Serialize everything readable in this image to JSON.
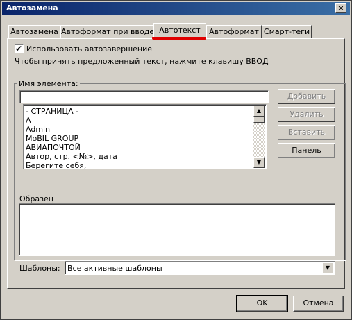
{
  "window": {
    "title": "Автозамена",
    "close_glyph": "×"
  },
  "tabs": [
    {
      "label": "Автозамена"
    },
    {
      "label": "Автоформат при вводе"
    },
    {
      "label": "Автотекст"
    },
    {
      "label": "Автоформат"
    },
    {
      "label": "Смарт-теги"
    }
  ],
  "active_tab": "Автотекст",
  "autocomplete": {
    "checked": true,
    "label": "Использовать автозавершение"
  },
  "hint_text": "Чтобы принять предложенный текст, нажмите клавишу ВВОД",
  "entry": {
    "label": "Имя элемента:",
    "value": ""
  },
  "list_items": [
    "- СТРАНИЦА -",
    "A",
    "Admin",
    "MoBIL GROUP",
    "АВИАПОЧТОЙ",
    "Автор, стр. <№>, дата",
    "Берегите себя,"
  ],
  "buttons": {
    "add": "Добавить",
    "delete": "Удалить",
    "insert": "Вставить",
    "toolbar": "Панель"
  },
  "preview": {
    "label": "Образец"
  },
  "templates": {
    "label": "Шаблоны:",
    "selected": "Все активные шаблоны"
  },
  "footer": {
    "ok": "OK",
    "cancel": "Отмена"
  },
  "colors": {
    "titlebar": "#0a246a",
    "highlight": "#e00000",
    "face": "#d4d0c8"
  }
}
